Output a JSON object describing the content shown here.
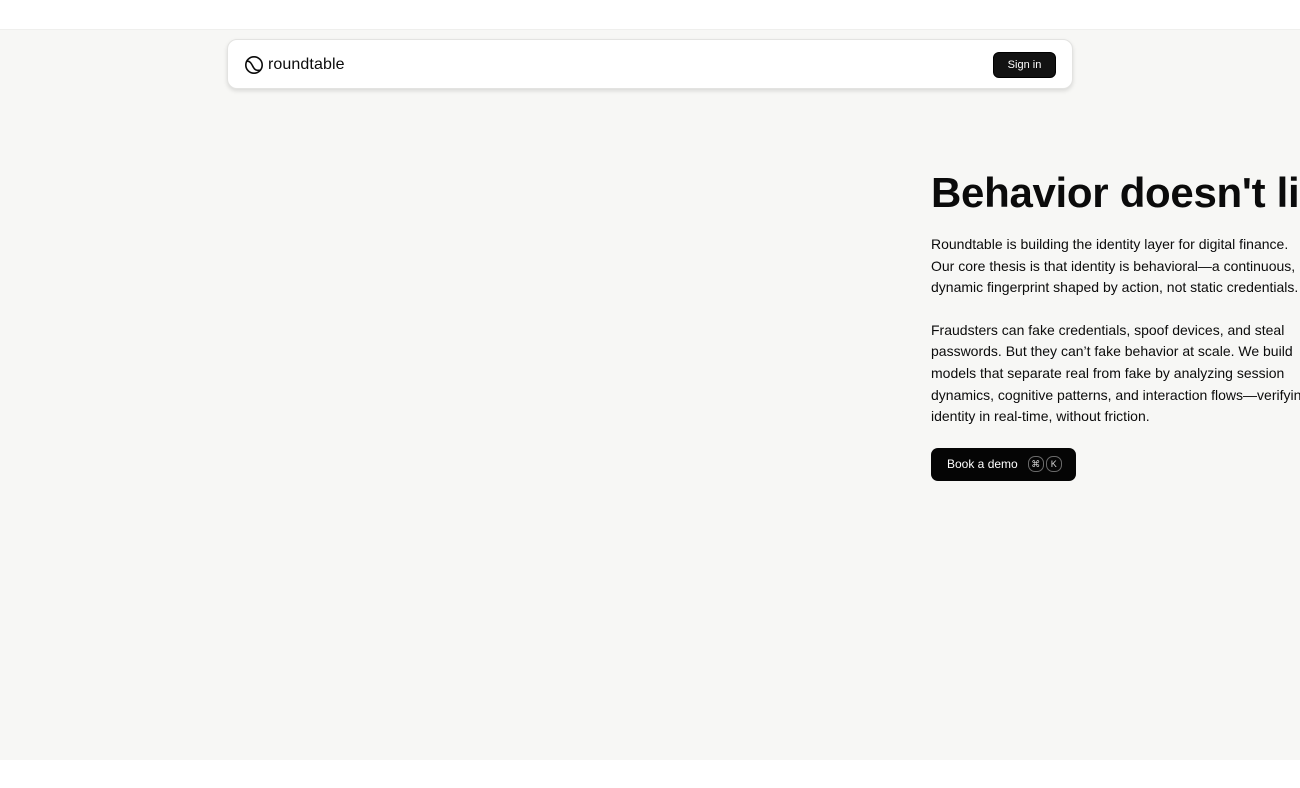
{
  "nav": {
    "brand_name": "roundtable",
    "brand_icon": "roundtable-logo-icon",
    "signin_label": "Sign in"
  },
  "hero": {
    "title": "Behavior doesn't lie",
    "paragraph1": "Roundtable is building the identity layer for digital finance.\nOur core thesis is that identity is behavioral—a continuous,\ndynamic fingerprint shaped by action, not static credentials.",
    "paragraph2": "Fraudsters can fake credentials, spoof devices, and steal\npasswords. But they can’t fake behavior at scale. We build\nmodels that separate real from fake by analyzing session\ndynamics, cognitive patterns, and interaction flows—verifying\nidentity in real-time, without friction.",
    "cta_label": "Book a demo",
    "cta_shortcut_keys": [
      "⌘",
      "K"
    ]
  },
  "colors": {
    "page_background": "#f7f7f5",
    "button_background": "#050505",
    "text": "#0b0b0b"
  }
}
